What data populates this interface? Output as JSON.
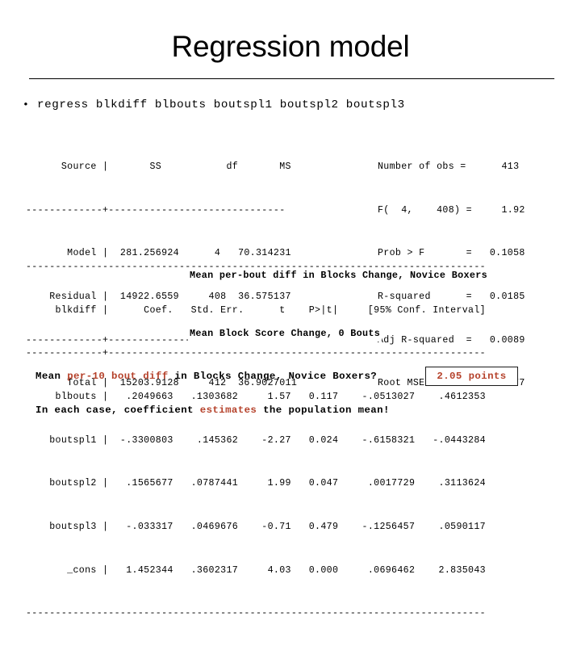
{
  "slide": {
    "title": "Regression model",
    "accent_color": "#b5412a",
    "text_color": "#000000",
    "background": "#ffffff"
  },
  "command": {
    "bullet": "•",
    "text": "regress blkdiff blbouts boutspl1 boutspl2 boutspl3"
  },
  "anova": {
    "lines": [
      "      Source |       SS           df       MS",
      "-------------+------------------------------",
      "       Model |  281.256924      4   70.314231",
      "    Residual |  14922.6559     408  36.575137",
      "-------------+------------------------------",
      "       Total |  15203.9128     412  36.9027011"
    ],
    "headers": [
      "Source",
      "SS",
      "df",
      "MS"
    ],
    "rows": [
      {
        "source": "Model",
        "ss": "281.256924",
        "df": "4",
        "ms": "70.314231"
      },
      {
        "source": "Residual",
        "ss": "14922.6559",
        "df": "408",
        "ms": "36.575137"
      },
      {
        "source": "Total",
        "ss": "15203.9128",
        "df": "412",
        "ms": "36.9027011"
      }
    ]
  },
  "stats": {
    "lines": [
      "Number of obs =      413",
      "F(  4,    408) =     1.92",
      "Prob > F       =   0.1058",
      "R-squared      =   0.0185",
      "Adj R-squared  =   0.0089",
      "Root MSE       =   6.0477"
    ],
    "items": [
      {
        "label": "Number of obs",
        "value": "413"
      },
      {
        "label": "F(  4,    408)",
        "value": "1.92"
      },
      {
        "label": "Prob > F",
        "value": "0.1058"
      },
      {
        "label": "R-squared",
        "value": "0.0185"
      },
      {
        "label": "Adj R-squared",
        "value": "0.0089"
      },
      {
        "label": "Root MSE",
        "value": "6.0477"
      }
    ]
  },
  "coefficients": {
    "lines": [
      "------------------------------------------------------------------------------",
      "     blkdiff |      Coef.   Std. Err.      t    P>|t|     [95% Conf. Interval]",
      "-------------+----------------------------------------------------------------",
      "     blbouts |   .2049663   .1303682     1.57   0.117    -.0513027    .4612353",
      "    boutspl1 |  -.3300803    .145362    -2.27   0.024    -.6158321   -.0443284",
      "    boutspl2 |   .1565677   .0787441     1.99   0.047     .0017729    .3113624",
      "    boutspl3 |   -.033317   .0469676    -0.71   0.479    -.1256457    .0590117",
      "       _cons |   1.452344   .3602317     4.03   0.000     .0696462    2.835043",
      "------------------------------------------------------------------------------"
    ],
    "headers": [
      "blkdiff",
      "Coef.",
      "Std. Err.",
      "t",
      "P>|t|",
      "[95% Conf. Interval]"
    ],
    "rows": [
      {
        "term": "blbouts",
        "coef": ".2049663",
        "std_err": "",
        "t": "",
        "p": "",
        "ci_low": "",
        "ci_high": ""
      },
      {
        "term": "boutspl1",
        "coef": "-.3300803",
        "std_err": ".145362",
        "t": "-2.27",
        "p": "0.024",
        "ci_low": "-.6158321",
        "ci_high": "-.0443284"
      },
      {
        "term": "boutspl2",
        "coef": ".1565677",
        "std_err": ".0787441",
        "t": "1.99",
        "p": "0.047",
        "ci_low": ".0017729",
        "ci_high": ".3113624"
      },
      {
        "term": "boutspl3",
        "coef": "-.033317",
        "std_err": ".0469676",
        "t": "-0.71",
        "p": "0.479",
        "ci_low": "-.1256457",
        "ci_high": ".0590117"
      },
      {
        "term": "_cons",
        "coef": "1.452344",
        "std_err": "",
        "t": "",
        "p": "",
        "ci_low": "696462",
        "ci_high": "2.835043"
      }
    ]
  },
  "overlays": {
    "per_bout": "Mean per-bout diff in Blocks Change, Novice Boxers",
    "constant": "Mean Block Score Change, 0 Bouts"
  },
  "notes": {
    "question_pre": "Mean ",
    "question_accent": "per-10 bout diff",
    "question_post": " in Blocks Change, Novice Boxers?",
    "answer": "2.05 points",
    "estimate_pre": "In each case, coefficient ",
    "estimate_accent": "estimates",
    "estimate_post": " the population mean!"
  }
}
